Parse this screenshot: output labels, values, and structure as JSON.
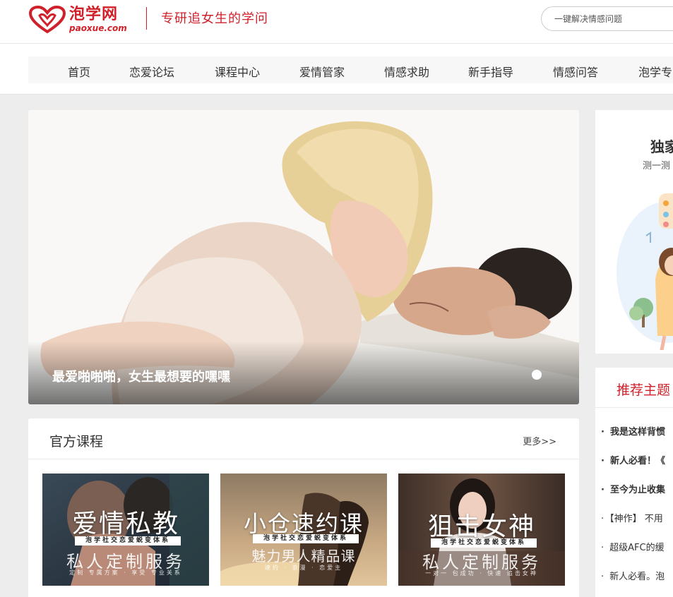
{
  "header": {
    "logo_name": "泡学网",
    "logo_domain": "paoxue.com",
    "slogan": "专研追女生的学问",
    "search_placeholder": "一键解决情感问题"
  },
  "nav": {
    "items": [
      "首页",
      "恋爱论坛",
      "课程中心",
      "爱情管家",
      "情感求助",
      "新手指导",
      "情感问答",
      "泡学专"
    ]
  },
  "banner": {
    "caption": "最爱啪啪啪，女生最想要的嘿嘿"
  },
  "courses": {
    "title": "官方课程",
    "more": "更多>>",
    "cards": [
      {
        "big": "爱情私教",
        "tag": "泡学社交恋爱蜕变体系",
        "sub": "私人定制服务",
        "foot": "定制 专属方案 · 享受 专业关系"
      },
      {
        "big": "小仓速约课",
        "tag": "泡学社交恋爱蜕变体系",
        "sub": "魅力男人精品课",
        "foot": "速约 · 浪漫 · 恋爱主"
      },
      {
        "big": "狙击女神",
        "tag": "泡学社交恋爱蜕变体系",
        "sub": "私人定制服务",
        "foot": "一对一 包成功 · 快速 追击女神"
      }
    ]
  },
  "promo": {
    "title": "独家",
    "subtitle": "测一测"
  },
  "topics": {
    "title": "推荐主题",
    "items": [
      {
        "text": "我是这样背惯",
        "bold": true
      },
      {
        "text": "新人必看！《",
        "bold": true
      },
      {
        "text": "至今为止收集",
        "bold": true
      },
      {
        "text": "【神作】 不用",
        "bold": false
      },
      {
        "text": "超级AFC的缓",
        "bold": false
      },
      {
        "text": "新人必看。泡",
        "bold": false
      }
    ]
  },
  "colors": {
    "brand_red": "#d0202a",
    "page_bg": "#ededed"
  }
}
